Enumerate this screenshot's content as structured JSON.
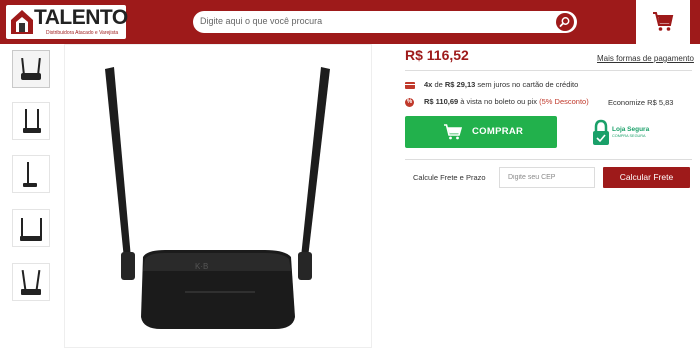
{
  "header": {
    "logo_text": "TALENTO",
    "logo_subtitle": "Distribuidora Atacado e Varejista",
    "search_placeholder": "Digite aqui o que você procura",
    "search_icon": "search-icon",
    "cart_icon": "cart-icon",
    "brand_color": "#9e1a1a"
  },
  "gallery": {
    "thumbnails": [
      "router-front",
      "router-angle-right",
      "router-side",
      "router-angle-left",
      "router-back"
    ],
    "main_image": "router-front"
  },
  "product": {
    "price": "R$ 116,52",
    "payment_link": "Mais formas de pagamento",
    "installments": {
      "count": "4x",
      "of": "de",
      "amount": "R$ 29,13",
      "suffix": "sem juros no cartão de crédito"
    },
    "cash": {
      "amount": "R$ 110,69",
      "suffix": "à vista no boleto ou pix",
      "discount": "(5% Desconto)"
    },
    "economize": "Economize R$ 5,83",
    "buy_button": "COMPRAR",
    "buy_color": "#22b14c",
    "secure": {
      "title": "Loja Segura",
      "subtitle": "COMPRA SEGURA"
    }
  },
  "shipping": {
    "label": "Calcule Frete e Prazo",
    "cep_placeholder": "Digite seu CEP",
    "button": "Calcular Frete"
  }
}
